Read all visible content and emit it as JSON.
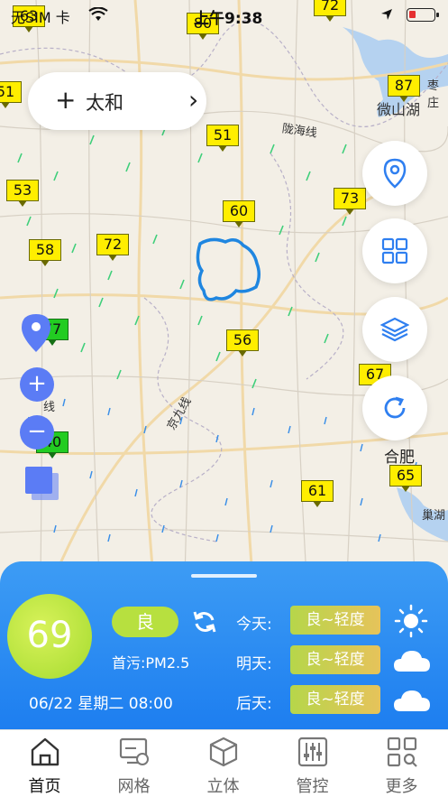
{
  "status_bar": {
    "carrier": "无SIM 卡",
    "time": "上午9:38"
  },
  "location": {
    "add_symbol": "+",
    "name": "太和",
    "arrow": "›"
  },
  "map": {
    "markers": [
      {
        "value": "63"
      },
      {
        "value": "80"
      },
      {
        "value": "72"
      },
      {
        "value": "87"
      },
      {
        "value": "51"
      },
      {
        "value": "53"
      },
      {
        "value": "60"
      },
      {
        "value": "73"
      },
      {
        "value": "58"
      },
      {
        "value": "72"
      },
      {
        "value": "56"
      },
      {
        "value": "67"
      },
      {
        "value": "61"
      },
      {
        "value": "65"
      },
      {
        "value": "51"
      },
      {
        "value": "77"
      },
      {
        "value": "40"
      }
    ],
    "labels": {
      "weishanhu": "微山湖",
      "hefei": "合肥",
      "longhai": "陇海线",
      "jingjiu": "京九线",
      "xian": "线",
      "chaohu": "巢湖",
      "zaozhuang": "枣庄"
    }
  },
  "panel": {
    "aqi": "69",
    "grade": "良",
    "primary_pollutant": "首污:PM2.5",
    "datetime": "06/22  星期二  08:00",
    "forecast": [
      {
        "day": "今天:",
        "level": "良~轻度",
        "icon": "sun-icon"
      },
      {
        "day": "明天:",
        "level": "良~轻度",
        "icon": "cloud-icon"
      },
      {
        "day": "后天:",
        "level": "良~轻度",
        "icon": "cloud-icon"
      }
    ],
    "colors": {
      "panel": "#2f8ff2",
      "good": "#b7e03f"
    }
  },
  "tabs": [
    {
      "label": "首页",
      "icon": "home-icon",
      "active": true
    },
    {
      "label": "网格",
      "icon": "grid-monitor-icon",
      "active": false
    },
    {
      "label": "立体",
      "icon": "cube-icon",
      "active": false
    },
    {
      "label": "管控",
      "icon": "sliders-icon",
      "active": false
    },
    {
      "label": "更多",
      "icon": "more-apps-icon",
      "active": false
    }
  ]
}
